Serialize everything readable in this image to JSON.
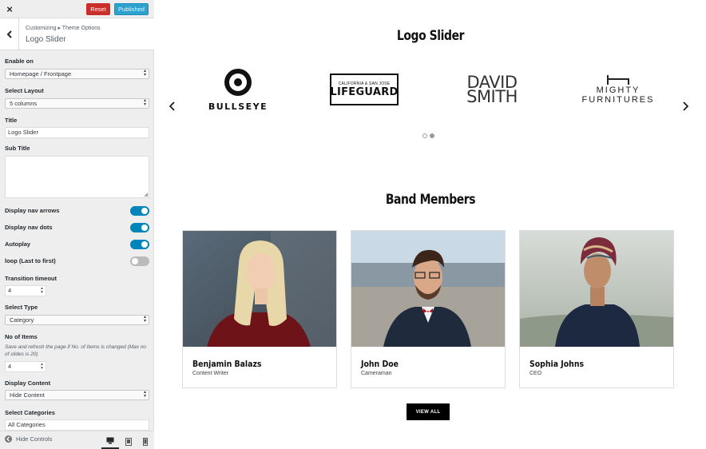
{
  "topbar": {
    "close_label": "×",
    "reset_label": "Reset",
    "publish_label": "Published"
  },
  "section": {
    "breadcrumb": "Customizing ▸ Theme Options",
    "title": "Logo Slider"
  },
  "fields": {
    "enable_on": {
      "label": "Enable on",
      "value": "Homepage / Frontpage"
    },
    "layout": {
      "label": "Select Layout",
      "value": "5 columns"
    },
    "title": {
      "label": "Title",
      "value": "Logo Slider"
    },
    "subtitle": {
      "label": "Sub Title",
      "value": ""
    },
    "nav_arrows": {
      "label": "Display nav arrows",
      "on": true
    },
    "nav_dots": {
      "label": "Display nav dots",
      "on": true
    },
    "autoplay": {
      "label": "Autoplay",
      "on": true
    },
    "loop": {
      "label": "loop (Last to first)",
      "on": false
    },
    "timeout": {
      "label": "Transition timeout",
      "value": "4"
    },
    "type": {
      "label": "Select Type",
      "value": "Category"
    },
    "items": {
      "label": "No of Items",
      "note": "Save and refresh the page if No. of Items is changed (Max no of slides is 20)",
      "value": "4"
    },
    "display_content": {
      "label": "Display Content",
      "value": "Hide Content"
    },
    "categories": {
      "label": "Select Categories",
      "value": "All Categories"
    }
  },
  "footer": {
    "hide_controls": "Hide Controls",
    "devices": [
      "desktop-icon",
      "tablet-icon",
      "mobile-icon"
    ],
    "active_device": "desktop"
  },
  "preview": {
    "logo_section_title": "Logo Slider",
    "logos": [
      {
        "name": "BULLSEYE"
      },
      {
        "small": "CALIFORNIA & SAN JOSE",
        "name": "LIFEGUARD"
      },
      {
        "line1": "DAVID",
        "line2": "SMITH"
      },
      {
        "line1": "MIGHTY",
        "line2": "FURNITURES"
      }
    ],
    "band_section_title": "Band Members",
    "members": [
      {
        "name": "Benjamin Balazs",
        "role": "Content Writer"
      },
      {
        "name": "John Doe",
        "role": "Cameraman"
      },
      {
        "name": "Sophia Johns",
        "role": "CEO"
      }
    ],
    "view_all_label": "VIEW ALL"
  },
  "colors": {
    "accent": "#0085ba",
    "reset": "#c9302c",
    "publish": "#2ea2cc"
  }
}
